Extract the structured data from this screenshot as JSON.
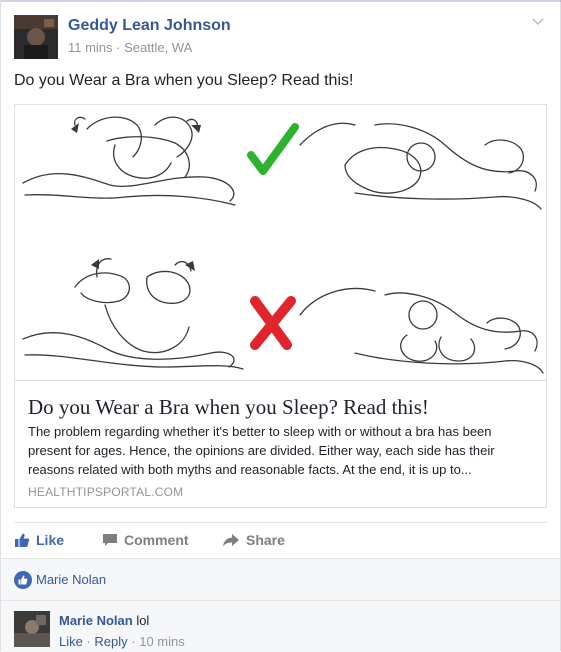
{
  "post": {
    "author": "Geddy Lean Johnson",
    "time": "11 mins",
    "separator": " · ",
    "location": "Seattle, WA",
    "text": "Do you Wear a Bra when you Sleep? Read this!"
  },
  "link_card": {
    "title": "Do you Wear a Bra when you Sleep? Read this!",
    "description": "The problem regarding whether it's better to sleep with or without a bra has been present for ages. Hence, the opinions are divided. Either way, each side has their reasons related with both myths and reasonable facts. At the end, it is up to...",
    "domain": "HEALTHTIPSPORTAL.COM",
    "image_icons": [
      "green-check-icon",
      "red-x-icon"
    ],
    "colors": {
      "check": "#2db22d",
      "cross": "#e0262b"
    }
  },
  "actions": {
    "like_label": "Like",
    "comment_label": "Comment",
    "share_label": "Share"
  },
  "likes": {
    "names": "Marie Nolan"
  },
  "comment": {
    "author": "Marie Nolan",
    "text": "lol",
    "like_label": "Like",
    "reply_label": "Reply",
    "separator": " · ",
    "time": "10 mins"
  },
  "colors": {
    "link_blue": "#365899",
    "like_blue": "#4267b2",
    "muted": "#90949c"
  }
}
